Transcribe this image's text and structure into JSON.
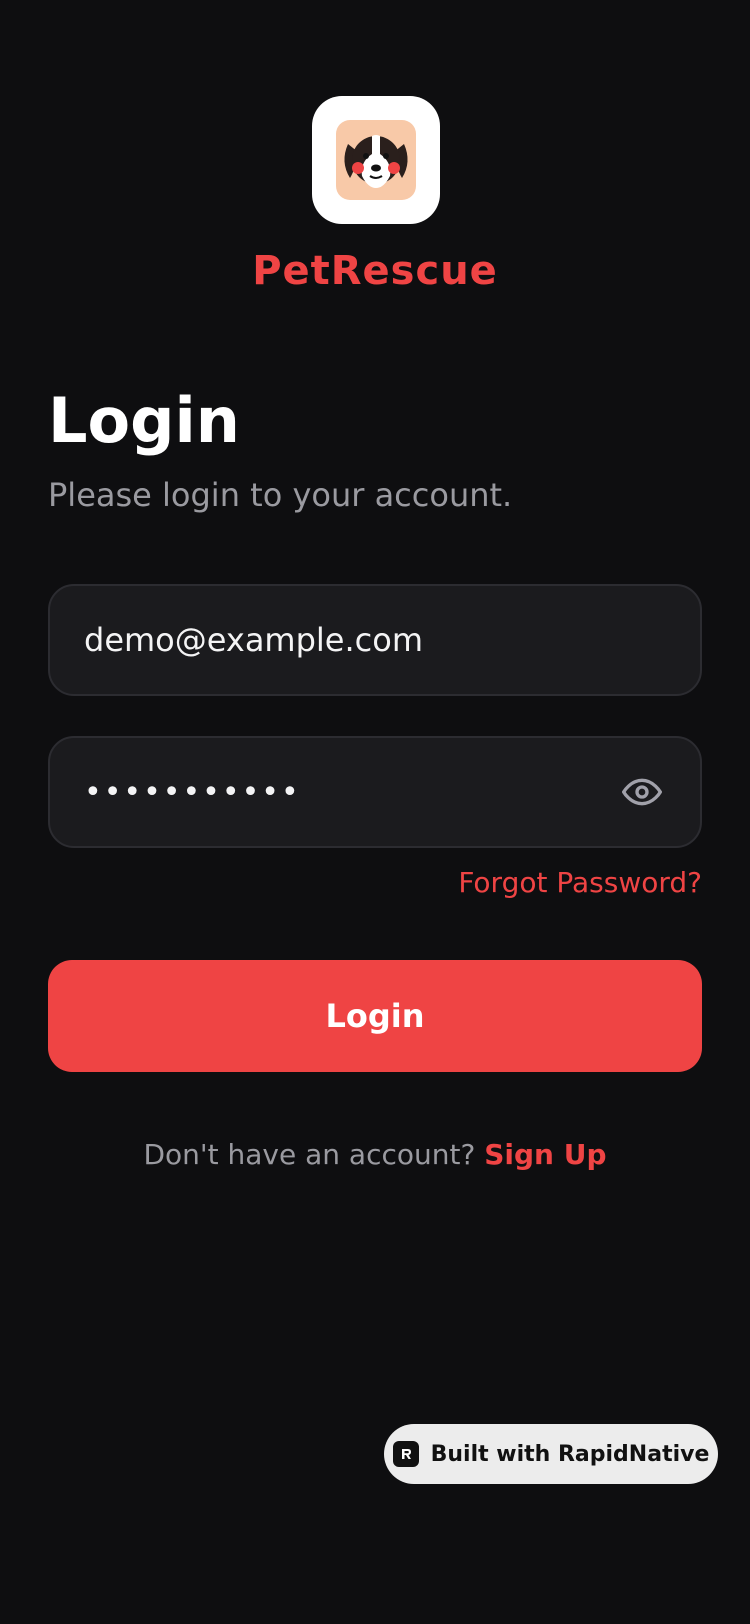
{
  "brand": {
    "app_name": "PetRescue",
    "logo_icon": "dog-face-icon",
    "accent_color": "#ef4444"
  },
  "header": {
    "title": "Login",
    "subtitle": "Please login to your account."
  },
  "form": {
    "email_value": "demo@example.com",
    "password_value": "•••••••••••",
    "password_toggle_icon": "eye-icon",
    "forgot_label": "Forgot Password?",
    "submit_label": "Login"
  },
  "footer": {
    "prompt": "Don't have an account?",
    "signup_label": "Sign Up"
  },
  "badge": {
    "label": "Built with RapidNative",
    "icon": "rapidnative-logo-icon"
  }
}
